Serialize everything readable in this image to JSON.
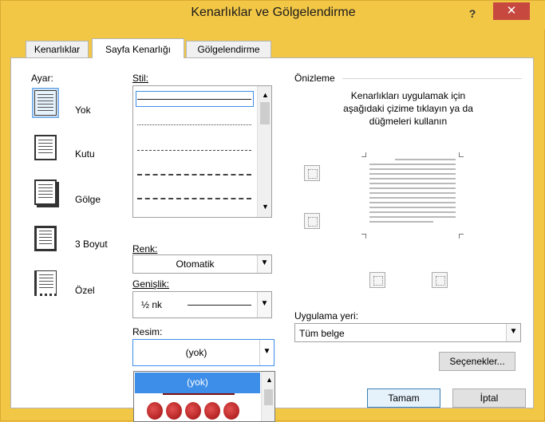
{
  "window": {
    "title": "Kenarlıklar ve Gölgelendirme",
    "help": "?",
    "close": "✕"
  },
  "tabs": [
    "Kenarlıklar",
    "Sayfa Kenarlığı",
    "Gölgelendirme"
  ],
  "settings": {
    "label": "Ayar:",
    "items": [
      "Yok",
      "Kutu",
      "Gölge",
      "3 Boyut",
      "Özel"
    ],
    "selected": "Yok"
  },
  "style": {
    "label": "Stil:"
  },
  "color": {
    "label": "Renk:",
    "value": "Otomatik"
  },
  "width": {
    "label": "Genişlik:",
    "value": "½ nk"
  },
  "art": {
    "label": "Resim:",
    "value": "(yok)",
    "option_selected": "(yok)"
  },
  "preview": {
    "label": "Önizleme",
    "instruction_line1": "Kenarlıkları uygulamak için",
    "instruction_line2": "aşağıdaki çizime tıklayın ya da",
    "instruction_line3": "düğmeleri kullanın"
  },
  "apply": {
    "label": "Uygulama yeri:",
    "value": "Tüm belge"
  },
  "buttons": {
    "options": "Seçenekler...",
    "ok": "Tamam",
    "cancel": "İptal"
  }
}
